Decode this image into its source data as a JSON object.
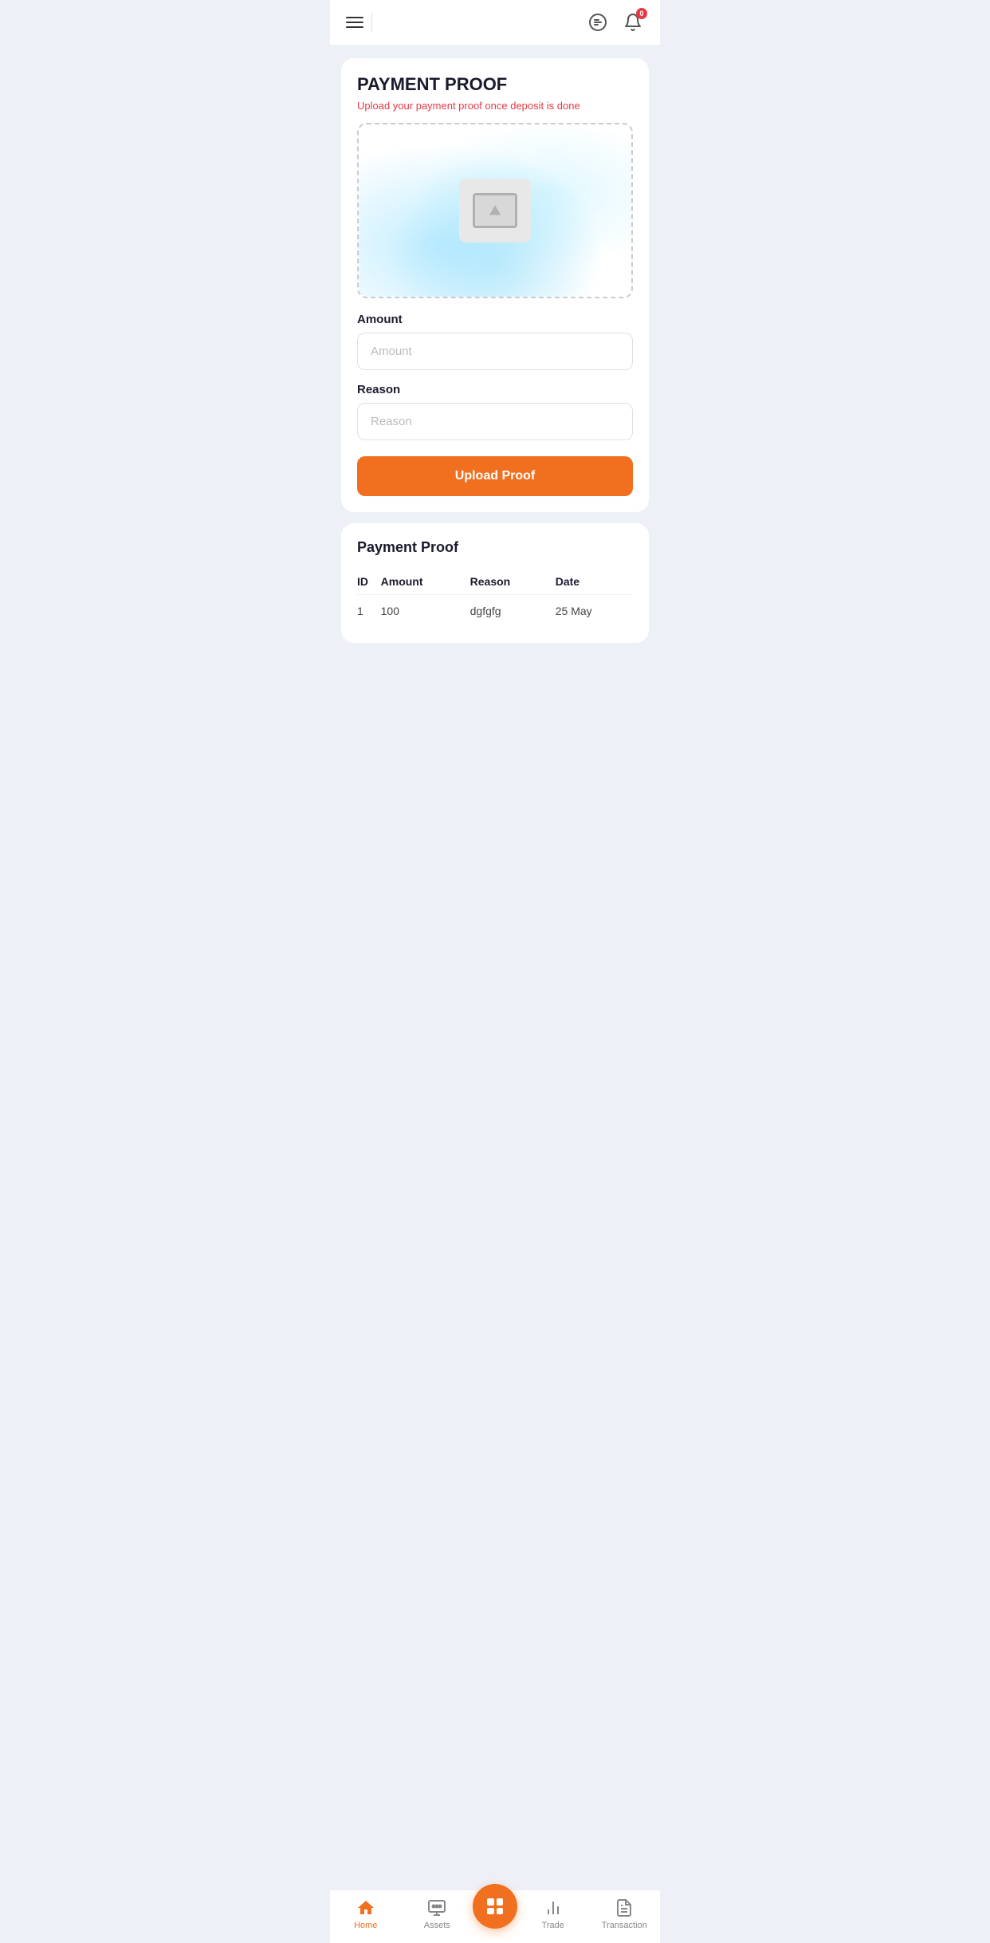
{
  "header": {
    "badge_count": "0"
  },
  "payment_proof_card": {
    "title": "PAYMENT PROOF",
    "subtitle": "Upload your payment proof once deposit is done",
    "amount_label": "Amount",
    "amount_placeholder": "Amount",
    "reason_label": "Reason",
    "reason_placeholder": "Reason",
    "upload_button": "Upload Proof"
  },
  "table_card": {
    "title": "Payment Proof",
    "columns": {
      "id": "ID",
      "amount": "Amount",
      "reason": "Reason",
      "date": "Date"
    },
    "rows": [
      {
        "id": "1",
        "amount": "100",
        "reason": "dgfgfg",
        "date": "25 May"
      }
    ]
  },
  "bottom_nav": {
    "home": "Home",
    "assets": "Assets",
    "trade": "Trade",
    "transaction": "Transaction"
  }
}
